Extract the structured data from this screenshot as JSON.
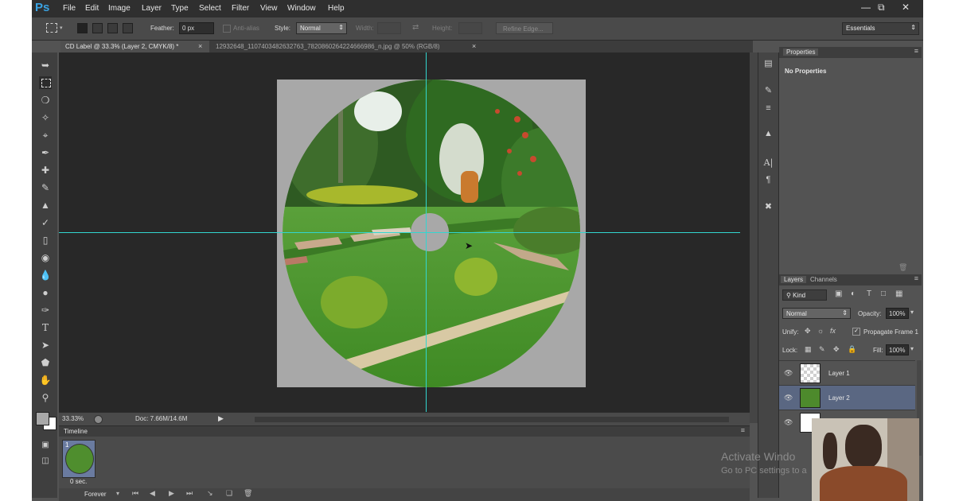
{
  "app": {
    "logo": "Ps",
    "menu": [
      "File",
      "Edit",
      "Image",
      "Layer",
      "Type",
      "Select",
      "Filter",
      "View",
      "Window",
      "Help"
    ]
  },
  "options_bar": {
    "feather_label": "Feather:",
    "feather_value": "0 px",
    "antialias_label": "Anti-alias",
    "style_label": "Style:",
    "style_value": "Normal",
    "width_label": "Width:",
    "height_label": "Height:",
    "refine_edge": "Refine Edge...",
    "workspace": "Essentials"
  },
  "tabs": [
    {
      "label": "CD Label @ 33.3% (Layer 2, CMYK/8) *",
      "close": "×"
    },
    {
      "label": "12932648_1107403482632763_782086026422466698​6_n.jpg @ 50% (RGB/8)",
      "close": "×"
    }
  ],
  "status": {
    "zoom": "33.33%",
    "doc": "Doc: 7.66M/14.6M"
  },
  "timeline": {
    "title": "Timeline",
    "frame_number": "1",
    "frame_delay": "0 sec.",
    "loop": "Forever"
  },
  "properties": {
    "title": "Properties",
    "empty_text": "No Properties"
  },
  "layers_panel": {
    "tab_layers": "Layers",
    "tab_channels": "Channels",
    "kind": "Kind",
    "blend_mode": "Normal",
    "opacity_label": "Opacity:",
    "opacity_value": "100%",
    "unify_label": "Unify:",
    "propagate_label": "Propagate Frame 1",
    "lock_label": "Lock:",
    "fill_label": "Fill:",
    "fill_value": "100%",
    "layers": [
      {
        "name": "Layer 1",
        "thumb": "transparent",
        "selected": false
      },
      {
        "name": "Layer 2",
        "thumb": "garden-photo",
        "selected": true
      },
      {
        "name": "",
        "thumb": "white",
        "selected": false
      }
    ]
  },
  "watermark": {
    "line1": "Activate Windo",
    "line2": "Go to PC settings to a"
  },
  "colors": {
    "guide": "#32d6d0",
    "selected_layer": "#5a6782",
    "canvas_bg": "#282828",
    "doc_bg": "#a8a8a8"
  }
}
